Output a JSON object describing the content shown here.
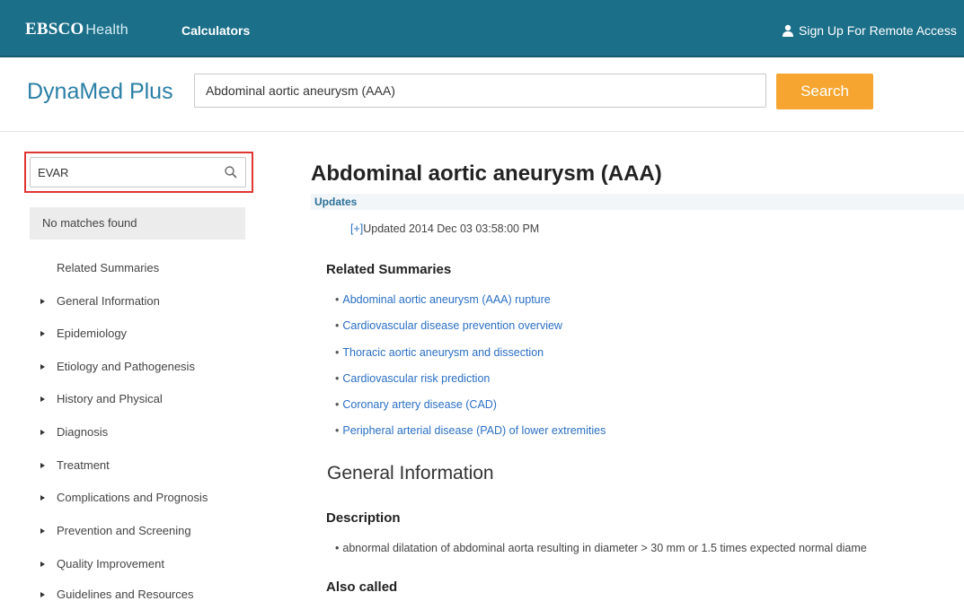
{
  "header": {
    "brand_main": "EBSCO",
    "brand_sub": "Health",
    "calculators": "Calculators",
    "remote_access": "Sign Up For Remote Access"
  },
  "search": {
    "logo": "DynaMed Plus",
    "query": "Abdominal aortic aneurysm (AAA)",
    "button": "Search"
  },
  "sidebar": {
    "search_value": "EVAR",
    "no_matches": "No matches found",
    "related_summaries": "Related Summaries",
    "items": [
      "General Information",
      "Epidemiology",
      "Etiology and Pathogenesis",
      "History and Physical",
      "Diagnosis",
      "Treatment",
      "Complications and Prognosis",
      "Prevention and Screening",
      "Quality Improvement",
      "Guidelines and Resources"
    ]
  },
  "content": {
    "title": "Abdominal aortic aneurysm (AAA)",
    "updates_label": "Updates",
    "update_toggle": "[+]",
    "update_text": "Updated 2014 Dec 03 03:58:00 PM",
    "related_heading": "Related Summaries",
    "related_links": [
      "Abdominal aortic aneurysm (AAA) rupture",
      "Cardiovascular disease prevention overview",
      "Thoracic aortic aneurysm and dissection",
      "Cardiovascular risk prediction",
      "Coronary artery disease (CAD)",
      "Peripheral arterial disease (PAD) of lower extremities"
    ],
    "general_info_heading": "General Information",
    "description_heading": "Description",
    "description_bullet": "abnormal dilatation of abdominal aorta resulting in diameter > 30 mm or 1.5 times expected normal diame",
    "also_called_heading": "Also called"
  },
  "colors": {
    "topbar": "#1b6f89",
    "search_button": "#f6a630",
    "link": "#2a6fc4",
    "highlight_border": "#e03535"
  },
  "icons": {
    "user": "user-icon",
    "search": "magnifier-icon",
    "bullet": "triangle-right-icon"
  }
}
